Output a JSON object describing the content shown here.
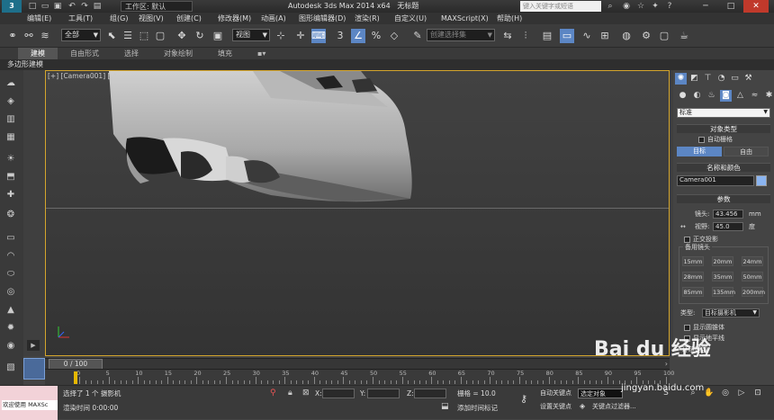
{
  "titlebar": {
    "logo": "3",
    "workspace": "工作区: 默认",
    "app_title": "Autodesk 3ds Max  2014 x64",
    "file_title": "无标题",
    "search_placeholder": "键入关键字或短语"
  },
  "menus": [
    "编辑(E)",
    "工具(T)",
    "组(G)",
    "视图(V)",
    "创建(C)",
    "修改器(M)",
    "动画(A)",
    "图形编辑器(D)",
    "渲染(R)",
    "自定义(U)",
    "MAXScript(X)",
    "帮助(H)"
  ],
  "toolbar": {
    "selection_filter": "全部",
    "reference_coord": "视图",
    "snap_num": "3",
    "selection_set_placeholder": "创建选择集"
  },
  "ribbon": {
    "tabs": [
      "建模",
      "自由形式",
      "选择",
      "对象绘制",
      "填充"
    ],
    "active": "建模",
    "subtitle": "多边形建模"
  },
  "viewport": {
    "label": "[+] [Camera001] [ A"
  },
  "cmdpanel": {
    "category": "标准",
    "object_type_head": "对象类型",
    "autogrid": "自动栅格",
    "btn_target": "目标",
    "btn_free": "自由",
    "name_color_head": "名称和颜色",
    "object_name": "Camera001",
    "object_color": "#8ab4f0",
    "params_head": "参数",
    "lens_label": "镜头:",
    "lens_value": "43.456",
    "lens_unit": "mm",
    "fov_label": "视野:",
    "fov_value": "45.0",
    "fov_unit": "度",
    "ortho": "正交投影",
    "stock_lens_head": "备用镜头",
    "stock_lenses": [
      "15mm",
      "20mm",
      "24mm",
      "28mm",
      "35mm",
      "50mm",
      "85mm",
      "135mm",
      "200mm"
    ],
    "type_label": "类型:",
    "type_value": "目标摄影机",
    "show_cone": "显示圆锥体",
    "show_horizon": "显示地平线",
    "env_range": "环境范围"
  },
  "timeline": {
    "slider": "0 / 100",
    "ticks": [
      "0",
      "5",
      "10",
      "15",
      "20",
      "25",
      "30",
      "35",
      "40",
      "45",
      "50",
      "55",
      "60",
      "65",
      "70",
      "75",
      "80",
      "85",
      "90",
      "95",
      "100"
    ]
  },
  "status": {
    "maxscript_label": "欢迎使用 MAXSc",
    "selected": "选择了 1 个 摄影机",
    "render_time": "渲染时间 0:00:00",
    "x_label": "X:",
    "y_label": "Y:",
    "z_label": "Z:",
    "grid": "栅格 = 10.0",
    "add_time_tag": "添加时间标记",
    "auto_key": "自动关键点",
    "set_key": "设置关键点",
    "key_filter_value": "选定对象",
    "key_filters": "关键点过滤器..."
  },
  "watermark": {
    "brand": "Bai du 经验",
    "url": "jingyan.baidu.com"
  }
}
